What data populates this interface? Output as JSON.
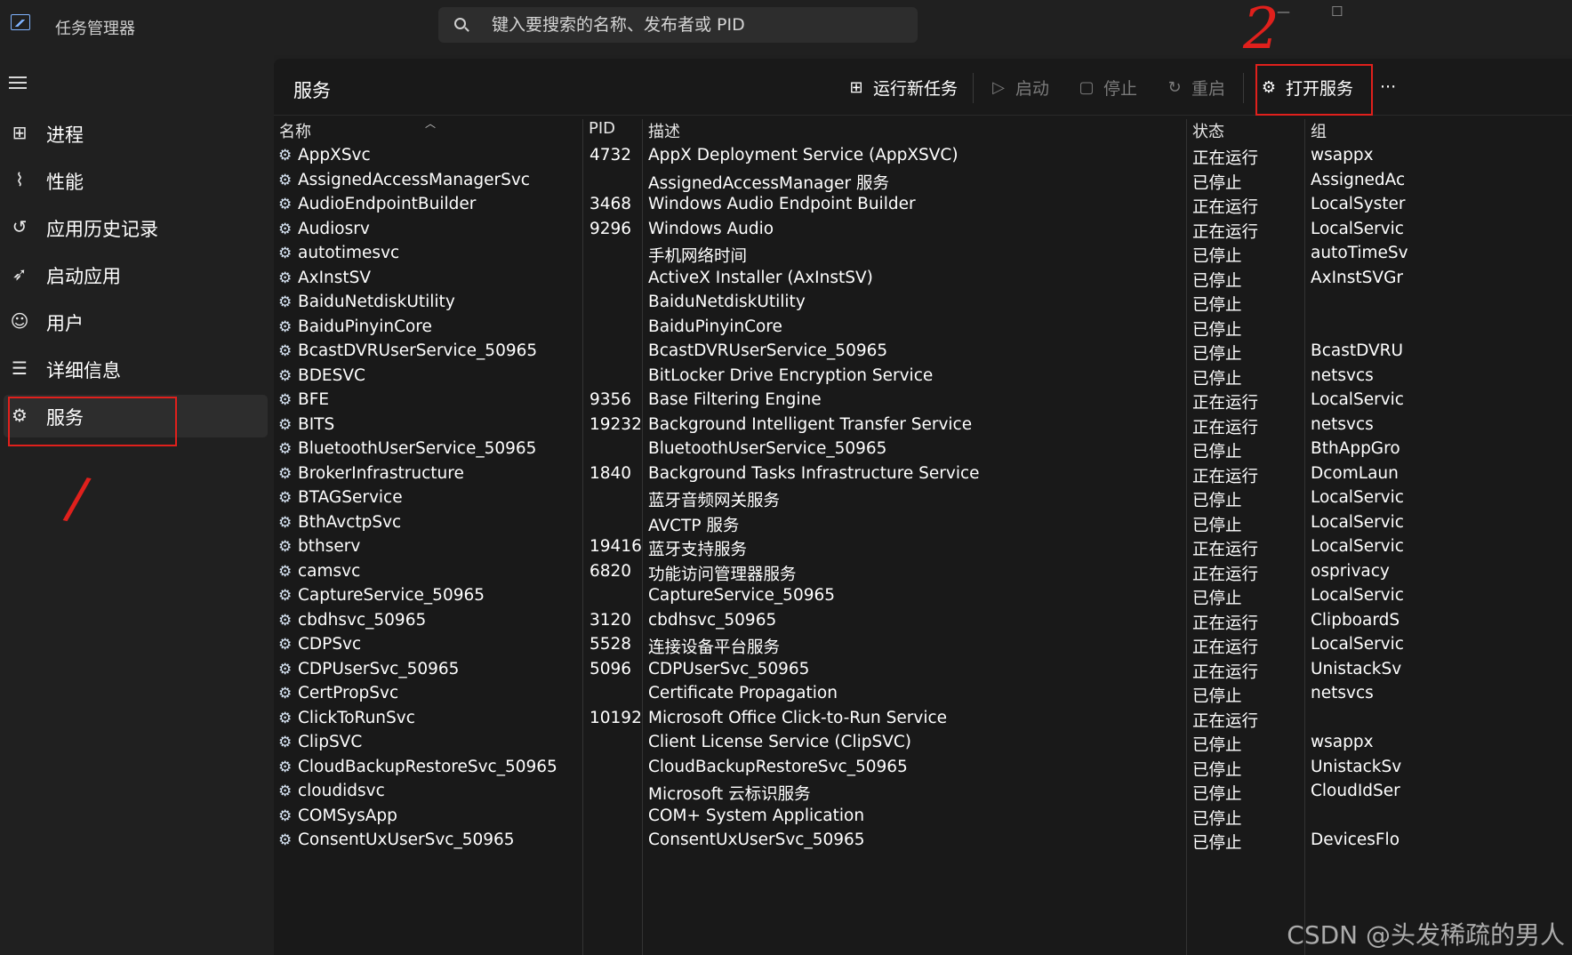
{
  "titlebar": {
    "app_title": "任务管理器",
    "search_placeholder": "键入要搜索的名称、发布者或 PID",
    "minimize": "—",
    "maximize": "☐"
  },
  "sidebar": {
    "items": [
      {
        "label": "进程",
        "icon": "grid-icon"
      },
      {
        "label": "性能",
        "icon": "performance-icon"
      },
      {
        "label": "应用历史记录",
        "icon": "history-icon"
      },
      {
        "label": "启动应用",
        "icon": "startup-icon"
      },
      {
        "label": "用户",
        "icon": "users-icon"
      },
      {
        "label": "详细信息",
        "icon": "details-list-icon"
      },
      {
        "label": "服务",
        "icon": "services-gear-icon",
        "active": true
      }
    ]
  },
  "toolbar": {
    "title": "服务",
    "run_new_task": "运行新任务",
    "start": "启动",
    "stop": "停止",
    "restart": "重启",
    "open_services": "打开服务",
    "more": "···"
  },
  "table": {
    "headers": {
      "name": "名称",
      "pid": "PID",
      "desc": "描述",
      "status": "状态",
      "group": "组"
    },
    "rows": [
      {
        "name": "AppXSvc",
        "pid": "4732",
        "desc": "AppX Deployment Service (AppXSVC)",
        "status": "正在运行",
        "group": "wsappx"
      },
      {
        "name": "AssignedAccessManagerSvc",
        "pid": "",
        "desc": "AssignedAccessManager 服务",
        "status": "已停止",
        "group": "AssignedAc"
      },
      {
        "name": "AudioEndpointBuilder",
        "pid": "3468",
        "desc": "Windows Audio Endpoint Builder",
        "status": "正在运行",
        "group": "LocalSyster"
      },
      {
        "name": "Audiosrv",
        "pid": "9296",
        "desc": "Windows Audio",
        "status": "正在运行",
        "group": "LocalServic"
      },
      {
        "name": "autotimesvc",
        "pid": "",
        "desc": "手机网络时间",
        "status": "已停止",
        "group": "autoTimeSv"
      },
      {
        "name": "AxInstSV",
        "pid": "",
        "desc": "ActiveX Installer (AxInstSV)",
        "status": "已停止",
        "group": "AxInstSVGr"
      },
      {
        "name": "BaiduNetdiskUtility",
        "pid": "",
        "desc": "BaiduNetdiskUtility",
        "status": "已停止",
        "group": ""
      },
      {
        "name": "BaiduPinyinCore",
        "pid": "",
        "desc": "BaiduPinyinCore",
        "status": "已停止",
        "group": ""
      },
      {
        "name": "BcastDVRUserService_50965",
        "pid": "",
        "desc": "BcastDVRUserService_50965",
        "status": "已停止",
        "group": "BcastDVRU"
      },
      {
        "name": "BDESVC",
        "pid": "",
        "desc": "BitLocker Drive Encryption Service",
        "status": "已停止",
        "group": "netsvcs"
      },
      {
        "name": "BFE",
        "pid": "9356",
        "desc": "Base Filtering Engine",
        "status": "正在运行",
        "group": "LocalServic"
      },
      {
        "name": "BITS",
        "pid": "19232",
        "desc": "Background Intelligent Transfer Service",
        "status": "正在运行",
        "group": "netsvcs"
      },
      {
        "name": "BluetoothUserService_50965",
        "pid": "",
        "desc": "BluetoothUserService_50965",
        "status": "已停止",
        "group": "BthAppGro"
      },
      {
        "name": "BrokerInfrastructure",
        "pid": "1840",
        "desc": "Background Tasks Infrastructure Service",
        "status": "正在运行",
        "group": "DcomLaun"
      },
      {
        "name": "BTAGService",
        "pid": "",
        "desc": "蓝牙音频网关服务",
        "status": "已停止",
        "group": "LocalServic"
      },
      {
        "name": "BthAvctpSvc",
        "pid": "",
        "desc": "AVCTP 服务",
        "status": "已停止",
        "group": "LocalServic"
      },
      {
        "name": "bthserv",
        "pid": "19416",
        "desc": "蓝牙支持服务",
        "status": "正在运行",
        "group": "LocalServic"
      },
      {
        "name": "camsvc",
        "pid": "6820",
        "desc": "功能访问管理器服务",
        "status": "正在运行",
        "group": "osprivacy"
      },
      {
        "name": "CaptureService_50965",
        "pid": "",
        "desc": "CaptureService_50965",
        "status": "已停止",
        "group": "LocalServic"
      },
      {
        "name": "cbdhsvc_50965",
        "pid": "3120",
        "desc": "cbdhsvc_50965",
        "status": "正在运行",
        "group": "ClipboardS"
      },
      {
        "name": "CDPSvc",
        "pid": "5528",
        "desc": "连接设备平台服务",
        "status": "正在运行",
        "group": "LocalServic"
      },
      {
        "name": "CDPUserSvc_50965",
        "pid": "5096",
        "desc": "CDPUserSvc_50965",
        "status": "正在运行",
        "group": "UnistackSv"
      },
      {
        "name": "CertPropSvc",
        "pid": "",
        "desc": "Certificate Propagation",
        "status": "已停止",
        "group": "netsvcs"
      },
      {
        "name": "ClickToRunSvc",
        "pid": "10192",
        "desc": "Microsoft Office Click-to-Run Service",
        "status": "正在运行",
        "group": ""
      },
      {
        "name": "ClipSVC",
        "pid": "",
        "desc": "Client License Service (ClipSVC)",
        "status": "已停止",
        "group": "wsappx"
      },
      {
        "name": "CloudBackupRestoreSvc_50965",
        "pid": "",
        "desc": "CloudBackupRestoreSvc_50965",
        "status": "已停止",
        "group": "UnistackSv"
      },
      {
        "name": "cloudidsvc",
        "pid": "",
        "desc": "Microsoft 云标识服务",
        "status": "已停止",
        "group": "CloudIdSer"
      },
      {
        "name": "COMSysApp",
        "pid": "",
        "desc": "COM+ System Application",
        "status": "已停止",
        "group": ""
      },
      {
        "name": "ConsentUxUserSvc_50965",
        "pid": "",
        "desc": "ConsentUxUserSvc_50965",
        "status": "已停止",
        "group": "DevicesFlo"
      }
    ]
  },
  "annotations": {
    "mark_1": "/",
    "mark_2": "2"
  },
  "watermark": "CSDN @头发稀疏的男人",
  "colors": {
    "annotation_red": "#e0201c",
    "background": "#191919",
    "sidebar": "#202020"
  }
}
